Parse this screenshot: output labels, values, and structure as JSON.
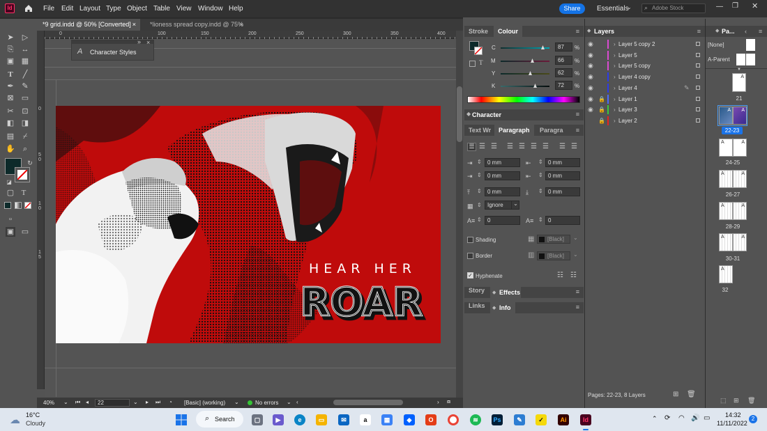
{
  "menu": {
    "app_icon": "Id",
    "items": [
      "File",
      "Edit",
      "Layout",
      "Type",
      "Object",
      "Table",
      "View",
      "Window",
      "Help"
    ],
    "share": "Share",
    "workspace": "Essentials",
    "search_placeholder": "Adobe Stock"
  },
  "tabs": [
    {
      "label": "*9 grid.indd @ 50% [Converted]"
    },
    {
      "label": "*lioness spread copy.indd @ 75%"
    }
  ],
  "ruler": {
    "h": [
      "0",
      "100",
      "150",
      "200",
      "250",
      "300",
      "350",
      "400"
    ],
    "v": [
      "0",
      "5",
      "0",
      "1",
      "0",
      "1",
      "5"
    ]
  },
  "char_styles_panel": {
    "title": "Character Styles"
  },
  "artwork": {
    "line1": "HEAR HER",
    "line2": "ROAR",
    "colors": {
      "background": "#bf0b0b",
      "ink": "#111111",
      "text": "#ffffff"
    }
  },
  "status": {
    "zoom": "40%",
    "page": "22",
    "preflight_profile": "[Basic] (working)",
    "errors": "No errors"
  },
  "stroke_colour_panel": {
    "tab_stroke": "Stroke",
    "tab_colour": "Colour",
    "c_label": "C",
    "c_value": "87",
    "m_label": "M",
    "m_value": "66",
    "y_label": "Y",
    "y_value": "62",
    "k_label": "K",
    "k_value": "72",
    "unit": "%",
    "swatch_color": "#0d2a2a"
  },
  "character_panel": {
    "title": "Character"
  },
  "paragraph_panel": {
    "tab_textwrap": "Text Wr",
    "tab_paragraph": "Paragraph",
    "tab_paragraph_styles": "Paragra",
    "left_indent": "0 mm",
    "right_indent": "0 mm",
    "first_line_indent": "0 mm",
    "last_line_indent": "0 mm",
    "space_before": "0 mm",
    "space_after": "0 mm",
    "align_to_grid": "Ignore",
    "drop_cap_lines": "0",
    "drop_cap_chars": "0",
    "shading_label": "Shading",
    "shading_color": "[Black]",
    "border_label": "Border",
    "border_color": "[Black]",
    "hyphenate_label": "Hyphenate"
  },
  "story_effects": {
    "tab_story": "Story",
    "tab_effects": "Effects"
  },
  "links_info": {
    "tab_links": "Links",
    "tab_info": "Info"
  },
  "layers_panel": {
    "title": "Layers",
    "layers": [
      {
        "name": "Layer 5 copy 2",
        "color": "#d94ad1"
      },
      {
        "name": "Layer 5",
        "color": "#d94ad1"
      },
      {
        "name": "Layer 5 copy",
        "color": "#d94ad1"
      },
      {
        "name": "Layer 4 copy",
        "color": "#2c3be6"
      },
      {
        "name": "Layer 4",
        "color": "#2c3be6"
      },
      {
        "name": "Layer 1",
        "color": "#4a6bff"
      },
      {
        "name": "Layer 3",
        "color": "#39c93c"
      },
      {
        "name": "Layer 2",
        "color": "#e62222"
      }
    ],
    "footer": "Pages: 22-23, 8 Layers"
  },
  "pages_panel": {
    "title": "Pa...",
    "none": "[None]",
    "parent": "A-Parent",
    "pages": [
      {
        "label": "21",
        "marker": "A"
      },
      {
        "label": "22-23",
        "marker": "A"
      },
      {
        "label": "24-25",
        "marker": "A"
      },
      {
        "label": "26-27",
        "marker": "A"
      },
      {
        "label": "28-29",
        "marker": "A"
      },
      {
        "label": "30-31",
        "marker": "A"
      },
      {
        "label": "32",
        "marker": "A"
      }
    ]
  },
  "taskbar": {
    "weather_temp": "16°C",
    "weather_desc": "Cloudy",
    "search": "Search",
    "time": "14:32",
    "date": "11/11/2022",
    "notifications": "2",
    "app_ps": "Ps",
    "app_ai": "Ai",
    "app_id": "Id"
  }
}
